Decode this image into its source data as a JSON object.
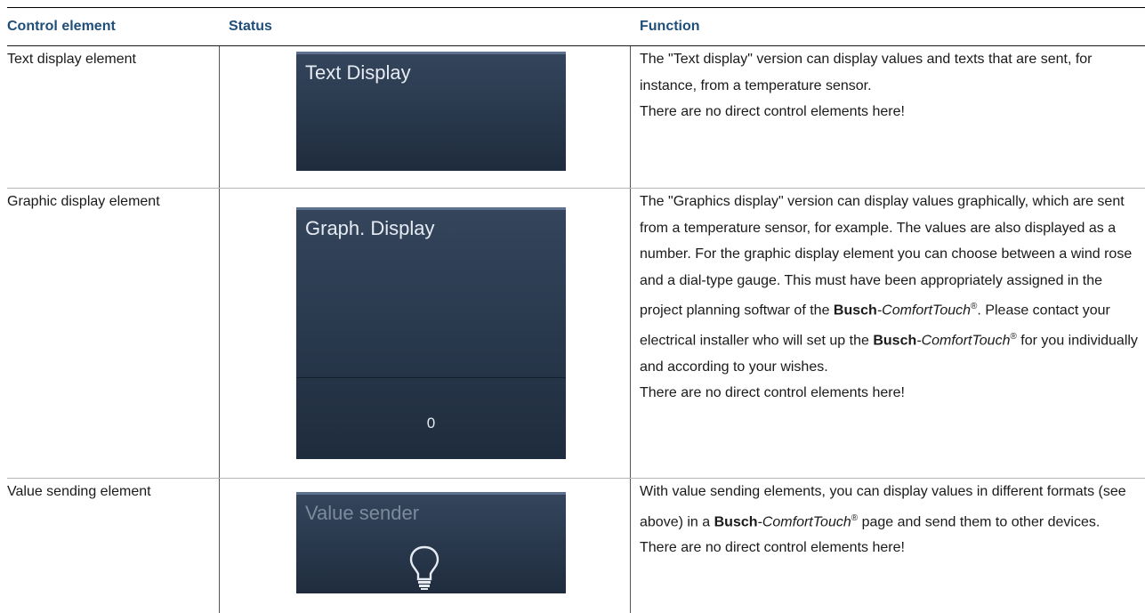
{
  "headers": {
    "control": "Control element",
    "status": "Status",
    "function": "Function"
  },
  "rows": [
    {
      "control": "Text display element",
      "panel_title": "Text Display",
      "function": [
        "The \"Text display\" version can display values and texts that are sent, for instance, from a temperature sensor.",
        "There are no direct control elements here!"
      ]
    },
    {
      "control": "Graphic display element",
      "panel_title": "Graph. Display",
      "panel_value": "0",
      "function": {
        "p1": "The \"Graphics display\" version can display values graphically, which are sent from a temperature sensor, for example. The values are also displayed as a number. For the graphic display element you can choose between a wind rose and a dial-type gauge. This must have been appropriately assigned in the project planning softwar of the ",
        "brand_bold": "Busch",
        "brand_italic": "-ComfortTouch",
        "reg": "®",
        "p1_end": ". Please contact your electrical installer who will set up the ",
        "p1_tail": " for you individually and according to your wishes.",
        "p2": "There are no direct control elements here!"
      }
    },
    {
      "control": "Value sending element",
      "panel_title": "Value sender",
      "icon": "lightbulb-icon",
      "function": {
        "p1_start": "With value sending elements, you can display values in different formats (see above) in a ",
        "p1_end": " page and send them to other devices.",
        "p2": "There are no direct control elements here!"
      }
    }
  ]
}
